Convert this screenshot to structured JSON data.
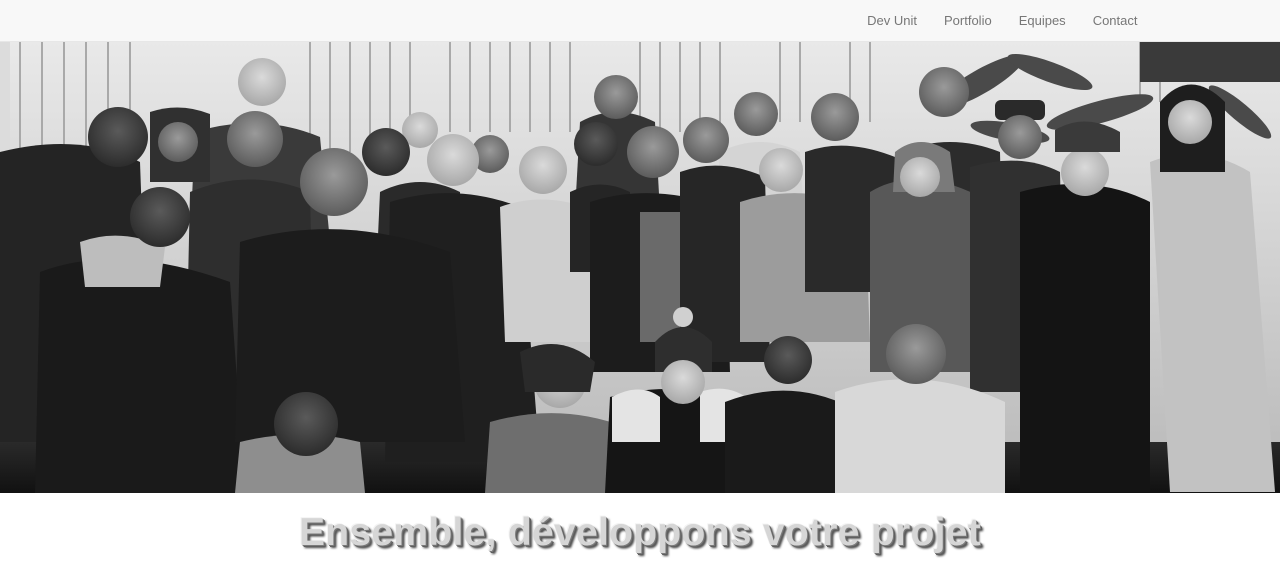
{
  "navbar": {
    "items": [
      {
        "label": "Dev Unit"
      },
      {
        "label": "Portfolio"
      },
      {
        "label": "Equipes"
      },
      {
        "label": "Contact"
      }
    ]
  },
  "hero": {
    "image_style": "grayscale group photo"
  },
  "tagline": {
    "text": "Ensemble, développons votre projet"
  }
}
